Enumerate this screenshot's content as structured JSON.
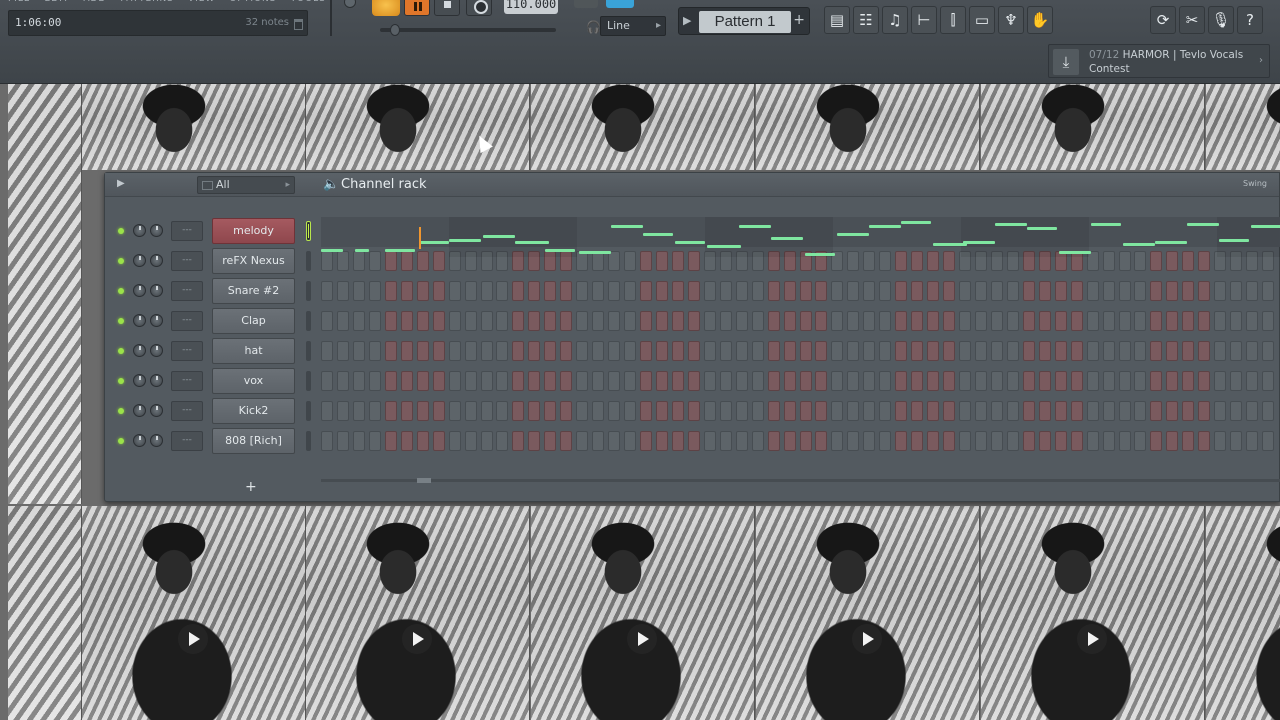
{
  "toolbar": {
    "menu": [
      "FILE",
      "EDIT",
      "ADD",
      "PATTERNS",
      "VIEW",
      "OPTIONS",
      "TOOLS"
    ],
    "song_position": "1:06:00",
    "notes_count": "32 notes",
    "tempo": "110.000",
    "snap_mode": "Line",
    "pattern_name": "Pattern 1",
    "news": {
      "date": "07/12",
      "text": "HARMOR | Tevlo Vocals Contest"
    }
  },
  "rack": {
    "title": "Channel rack",
    "filter": "All",
    "swing_label": "Swing",
    "mixer_placeholder": "---",
    "add_button": "+",
    "channels": [
      {
        "name": "melody",
        "selected": true
      },
      {
        "name": "reFX Nexus",
        "selected": false
      },
      {
        "name": "Snare #2",
        "selected": false
      },
      {
        "name": "Clap",
        "selected": false
      },
      {
        "name": "hat",
        "selected": false
      },
      {
        "name": "vox",
        "selected": false
      },
      {
        "name": "Kick2",
        "selected": false
      },
      {
        "name": "808 [Rich]",
        "selected": false
      }
    ]
  },
  "colors": {
    "accent_orange": "#f0962f",
    "channel_selected": "#a55a60",
    "led_green": "#9be24a",
    "note_green": "#7fe6a0"
  }
}
